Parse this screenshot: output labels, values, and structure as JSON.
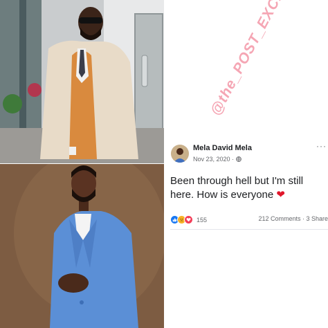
{
  "post": {
    "author": "Mela David Mela",
    "date": "Nov 23, 2020 · ",
    "text": "Been through hell but I'm still here. How is everyone",
    "heart": "❤",
    "reaction_count": "155",
    "comments_shares": "212 Comments · 3 Share",
    "more": "···"
  },
  "watermark": "@the_POST_EXCLUSIVE",
  "icons": {
    "globe": "globe-icon",
    "like": "like-reaction-icon",
    "sad": "sad-reaction-icon",
    "love": "love-reaction-icon"
  },
  "colors": {
    "like": "#1877f2",
    "sad": "#f7b125",
    "love": "#f33e58",
    "heart": "#e0162b",
    "watermark": "#ec5d76"
  }
}
